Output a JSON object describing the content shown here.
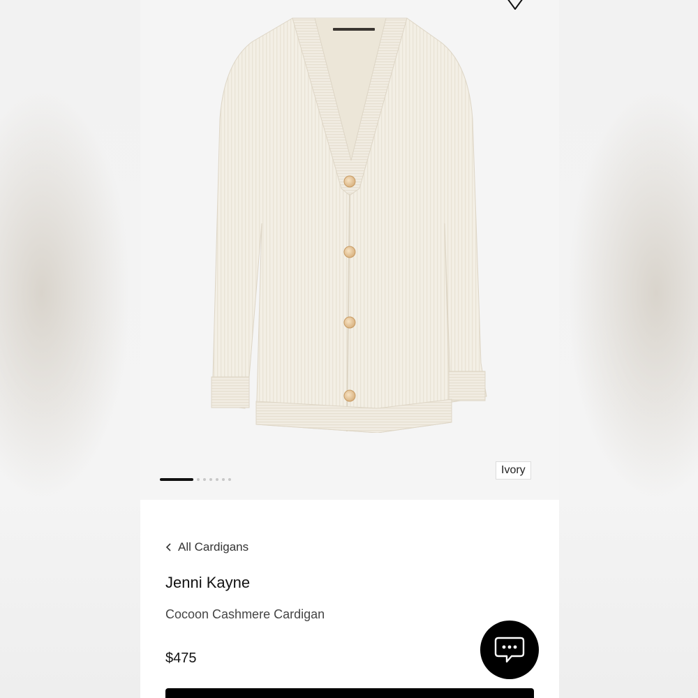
{
  "image_carousel": {
    "total_images": 7,
    "active_index": 0,
    "color_label": "Ivory",
    "photo_subject": "ivory ribbed cashmere cardigan with four tortoise buttons"
  },
  "breadcrumb": {
    "label": "All Cardigans",
    "icon": "chevron-left-icon"
  },
  "product": {
    "brand": "Jenni Kayne",
    "name": "Cocoon Cashmere Cardigan",
    "price": "$475"
  },
  "icons": {
    "wishlist": "heart-icon",
    "chat": "chat-bubble-icon"
  },
  "colors": {
    "page_bg": "#ffffff",
    "image_bg": "#f5f5f5",
    "garment": "#f3efe5",
    "button": "#e8c9a0",
    "primary": "#000000"
  }
}
